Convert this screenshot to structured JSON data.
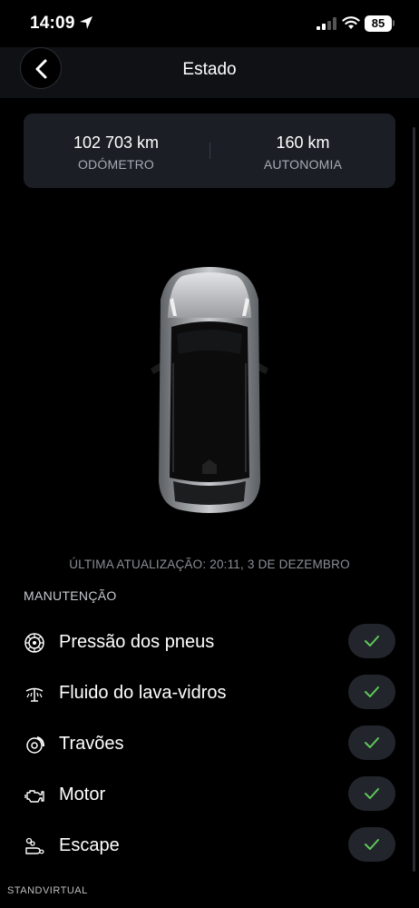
{
  "status_bar": {
    "time": "14:09",
    "battery": "85"
  },
  "header": {
    "title": "Estado"
  },
  "stats": [
    {
      "value": "102 703 km",
      "label": "ODÓMETRO"
    },
    {
      "value": "160 km",
      "label": "AUTONOMIA"
    }
  ],
  "last_update": "ÚLTIMA ATUALIZAÇÃO: 20:11, 3 DE DEZEMBRO",
  "section_title": "MANUTENÇÃO",
  "maintenance": [
    {
      "label": "Pressão dos pneus",
      "icon": "tire-icon",
      "status": "ok"
    },
    {
      "label": "Fluido do lava-vidros",
      "icon": "washer-fluid-icon",
      "status": "ok"
    },
    {
      "label": "Travões",
      "icon": "brake-icon",
      "status": "ok"
    },
    {
      "label": "Motor",
      "icon": "engine-icon",
      "status": "ok"
    },
    {
      "label": "Escape",
      "icon": "exhaust-icon",
      "status": "ok"
    }
  ],
  "watermark": "STANDVIRTUAL",
  "colors": {
    "background": "#000000",
    "card": "#1b1e25",
    "check": "#5fc85a"
  }
}
